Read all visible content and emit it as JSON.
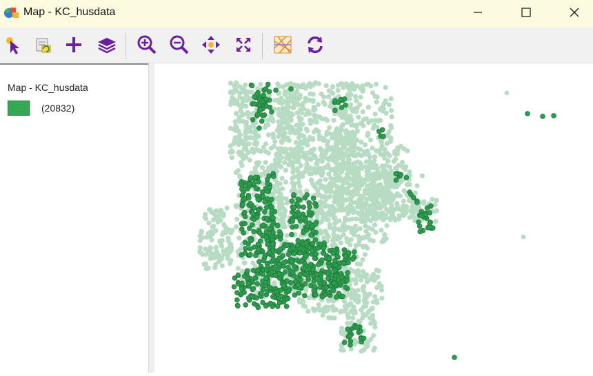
{
  "window": {
    "title": "Map - KC_husdata"
  },
  "toolbar": {
    "tools": [
      {
        "name": "select-tool-button",
        "icon": "pointer-select-icon"
      },
      {
        "name": "attributes-tool-button",
        "icon": "table-refresh-icon"
      },
      {
        "name": "add-layer-button",
        "icon": "plus-icon"
      },
      {
        "name": "layers-button",
        "icon": "layers-icon"
      },
      {
        "name": "zoom-in-button",
        "icon": "zoom-in-icon"
      },
      {
        "name": "zoom-out-button",
        "icon": "zoom-out-icon"
      },
      {
        "name": "pan-button",
        "icon": "pan-arrows-icon"
      },
      {
        "name": "full-extent-button",
        "icon": "fit-extent-icon"
      },
      {
        "name": "basemap-button",
        "icon": "basemap-icon"
      },
      {
        "name": "refresh-button",
        "icon": "refresh-icon"
      }
    ]
  },
  "legend": {
    "layer_title": "Map - KC_husdata",
    "entries": [
      {
        "count_label": "(20832)",
        "color": "#34a853"
      }
    ]
  },
  "colors": {
    "toolbar_icon": "#6a1fa3",
    "point_light": "#b7dcc3",
    "point_dark": "#2f9b4f",
    "point_dark_edge": "#1c7a38"
  }
}
